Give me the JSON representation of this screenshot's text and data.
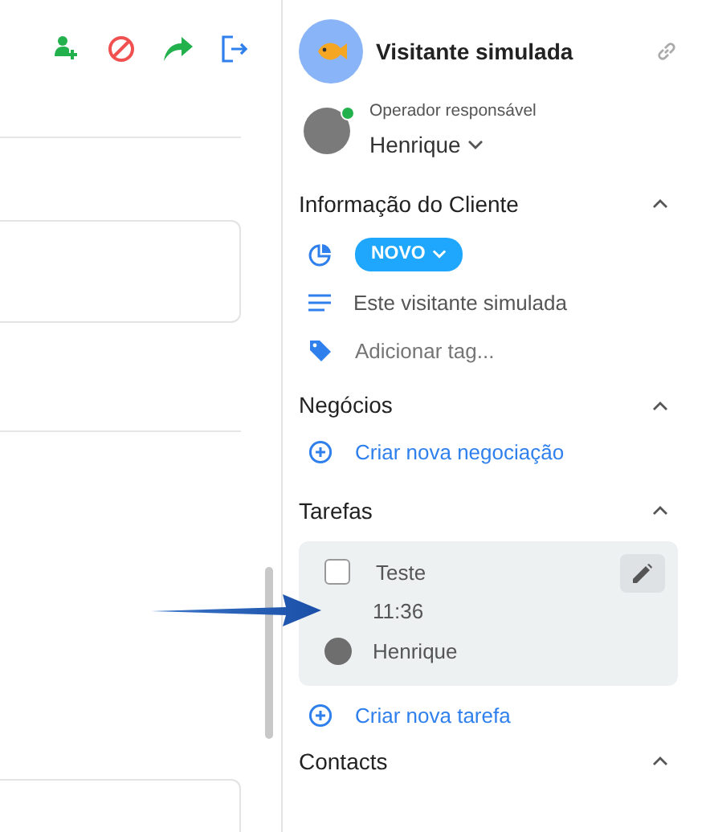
{
  "visitor": {
    "name": "Visitante simulada"
  },
  "operator": {
    "label": "Operador responsável",
    "name": "Henrique",
    "online": true
  },
  "sections": [
    {
      "kind": "info",
      "title": "Informação do Cliente",
      "expanded": true,
      "status": "NOVO",
      "description": "Este visitante simulada",
      "tag_placeholder": "Adicionar tag..."
    },
    {
      "kind": "deals",
      "title": "Negócios",
      "expanded": true,
      "action": "Criar nova negociação"
    },
    {
      "kind": "tasks",
      "title": "Tarefas",
      "expanded": true,
      "tasks": [
        {
          "title": "Teste",
          "time": "11:36",
          "assignee": "Henrique",
          "checked": false
        }
      ],
      "action": "Criar nova tarefa"
    },
    {
      "kind": "contacts",
      "title": "Contacts",
      "expanded": true
    }
  ]
}
